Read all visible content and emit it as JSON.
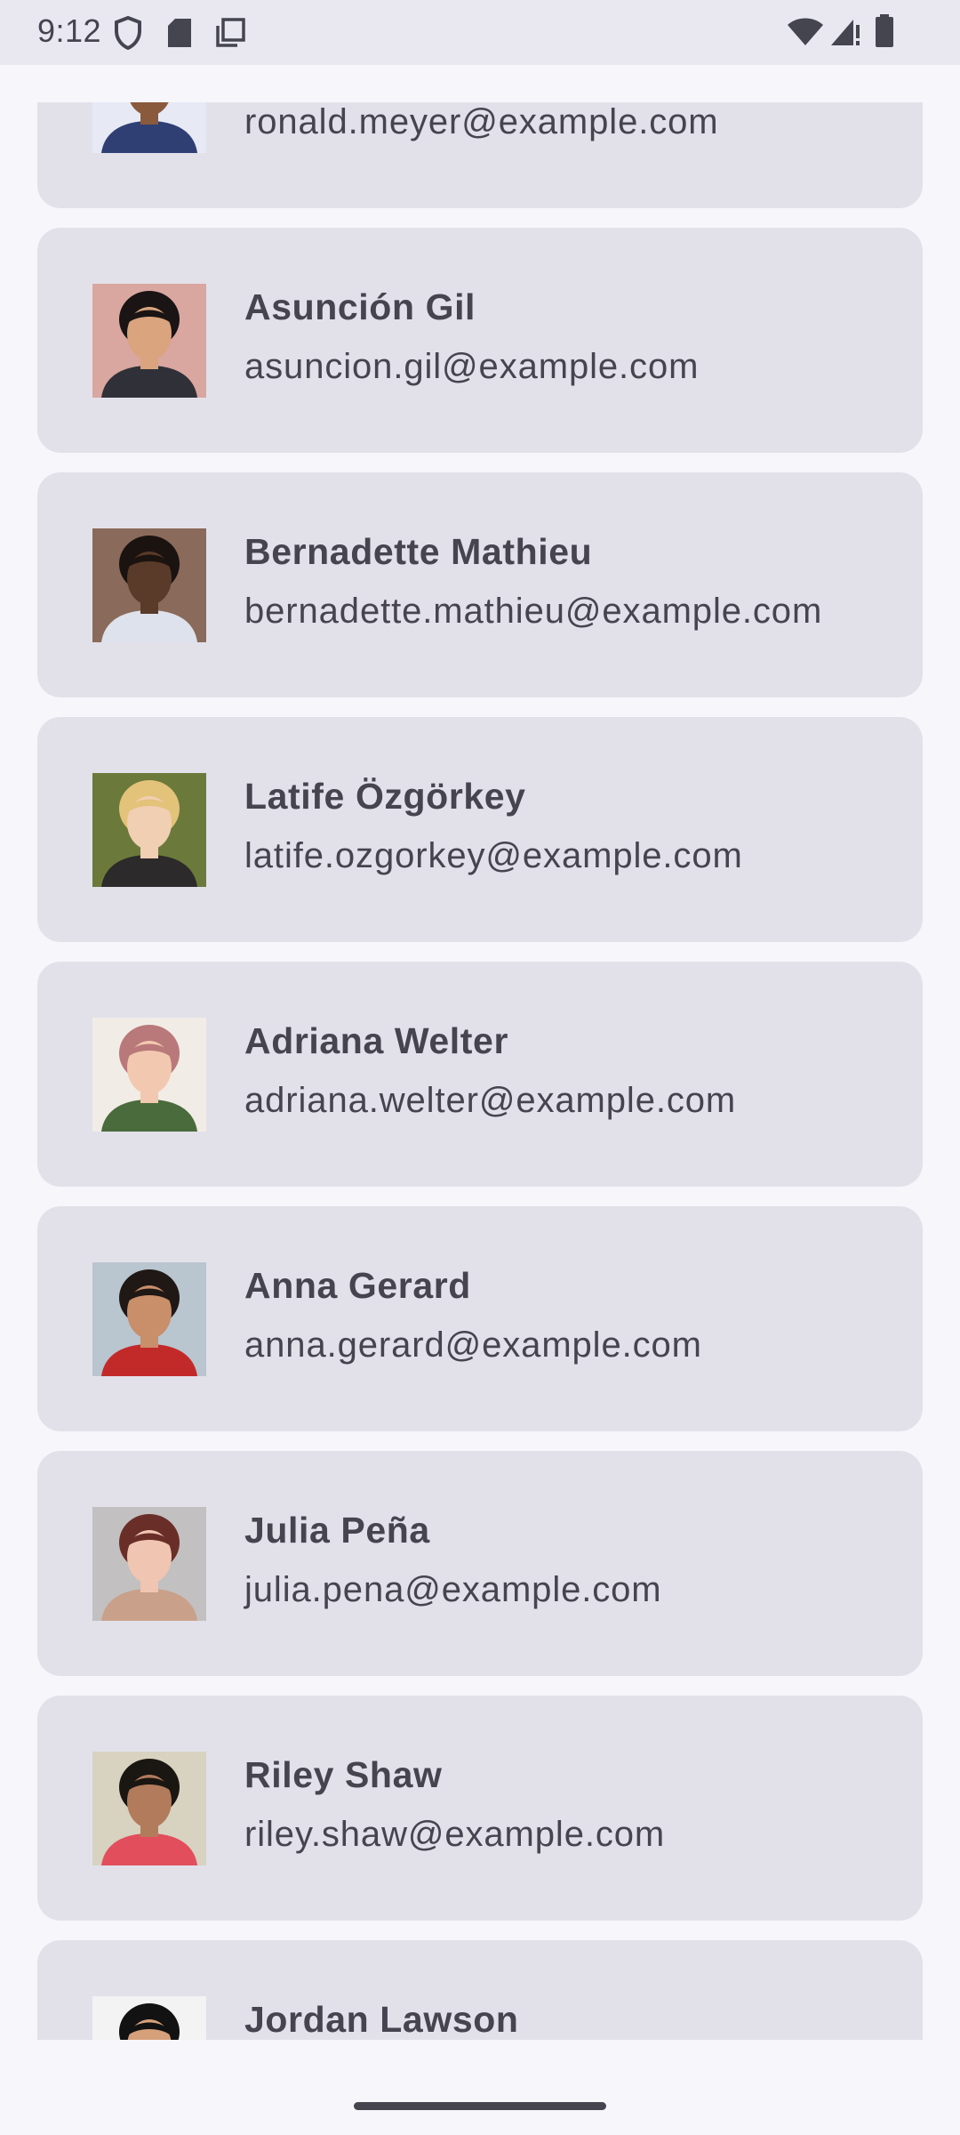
{
  "status_bar": {
    "time": "9:12",
    "left_icons": [
      "shield-icon",
      "sd-card-icon",
      "screenshot-icon"
    ],
    "right_icons": [
      "wifi-icon",
      "signal-icon",
      "battery-icon"
    ]
  },
  "contacts": [
    {
      "name": "",
      "email": "ronald.meyer@example.com",
      "avatar": {
        "bg": "#e7e9f5",
        "skin": "#8a5a3c",
        "hair": "#1e1a1c",
        "shirt": "#2f3f74"
      }
    },
    {
      "name": "Asunción Gil",
      "email": "asuncion.gil@example.com",
      "avatar": {
        "bg": "#d9a6a0",
        "skin": "#d9a47e",
        "hair": "#1a1414",
        "shirt": "#303038"
      }
    },
    {
      "name": "Bernadette Mathieu",
      "email": "bernadette.mathieu@example.com",
      "avatar": {
        "bg": "#8a6a5a",
        "skin": "#5a3a28",
        "hair": "#1b1310",
        "shirt": "#dde2ec"
      }
    },
    {
      "name": "Latife Özgörkey",
      "email": "latife.ozgorkey@example.com",
      "avatar": {
        "bg": "#6b7a3a",
        "skin": "#f0cfb3",
        "hair": "#e3c27a",
        "shirt": "#2c2a2a"
      }
    },
    {
      "name": "Adriana Welter",
      "email": "adriana.welter@example.com",
      "avatar": {
        "bg": "#f1ece6",
        "skin": "#f2c9b0",
        "hair": "#b9787a",
        "shirt": "#4a6b3c"
      }
    },
    {
      "name": "Anna Gerard",
      "email": "anna.gerard@example.com",
      "avatar": {
        "bg": "#b9c5cf",
        "skin": "#c98e6a",
        "hair": "#201815",
        "shirt": "#c22a2a"
      }
    },
    {
      "name": "Julia Peña",
      "email": "julia.pena@example.com",
      "avatar": {
        "bg": "#c2c0c0",
        "skin": "#f0c6b2",
        "hair": "#6a2e28",
        "shirt": "#c9a08a"
      }
    },
    {
      "name": "Riley Shaw",
      "email": "riley.shaw@example.com",
      "avatar": {
        "bg": "#d8d2c0",
        "skin": "#b27b5c",
        "hair": "#1a1612",
        "shirt": "#e24e5c"
      }
    },
    {
      "name": "Jordan Lawson",
      "email": "",
      "avatar": {
        "bg": "#f3f3f3",
        "skin": "#d5a07a",
        "hair": "#121212",
        "shirt": "#2a2a2a"
      }
    }
  ]
}
